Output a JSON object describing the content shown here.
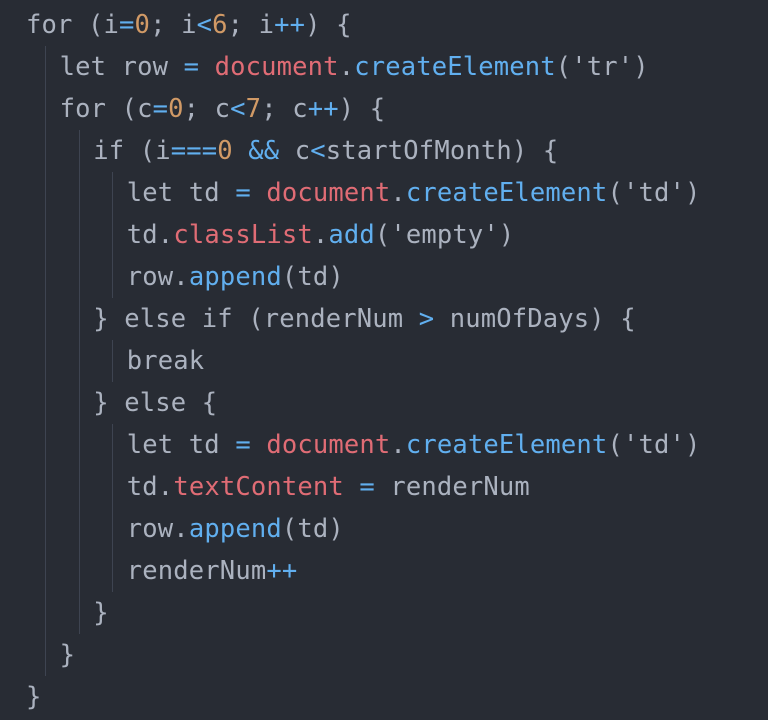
{
  "colors": {
    "background": "#282c34",
    "plain": "#abb2bf",
    "number": "#d19a66",
    "operator": "#61afef",
    "object": "#e06c75",
    "method": "#61afef",
    "property": "#e06c75",
    "guide": "#3e4451"
  },
  "code": {
    "lines": [
      {
        "indent": 0,
        "tokens": [
          {
            "t": "k",
            "v": "for "
          },
          {
            "t": "k",
            "v": "(i"
          },
          {
            "t": "o",
            "v": "="
          },
          {
            "t": "n",
            "v": "0"
          },
          {
            "t": "k",
            "v": "; i"
          },
          {
            "t": "o",
            "v": "<"
          },
          {
            "t": "n",
            "v": "6"
          },
          {
            "t": "k",
            "v": "; i"
          },
          {
            "t": "o",
            "v": "++"
          },
          {
            "t": "k",
            "v": ") {"
          }
        ]
      },
      {
        "indent": 1,
        "tokens": [
          {
            "t": "k",
            "v": "let row "
          },
          {
            "t": "o",
            "v": "="
          },
          {
            "t": "k",
            "v": " "
          },
          {
            "t": "obj",
            "v": "document"
          },
          {
            "t": "k",
            "v": "."
          },
          {
            "t": "fn",
            "v": "createElement"
          },
          {
            "t": "k",
            "v": "("
          },
          {
            "t": "s",
            "v": "'tr'"
          },
          {
            "t": "k",
            "v": ")"
          }
        ]
      },
      {
        "indent": 1,
        "tokens": [
          {
            "t": "k",
            "v": "for (c"
          },
          {
            "t": "o",
            "v": "="
          },
          {
            "t": "n",
            "v": "0"
          },
          {
            "t": "k",
            "v": "; c"
          },
          {
            "t": "o",
            "v": "<"
          },
          {
            "t": "n",
            "v": "7"
          },
          {
            "t": "k",
            "v": "; c"
          },
          {
            "t": "o",
            "v": "++"
          },
          {
            "t": "k",
            "v": ") {"
          }
        ]
      },
      {
        "indent": 2,
        "tokens": [
          {
            "t": "k",
            "v": "if (i"
          },
          {
            "t": "o",
            "v": "==="
          },
          {
            "t": "n",
            "v": "0"
          },
          {
            "t": "k",
            "v": " "
          },
          {
            "t": "o",
            "v": "&&"
          },
          {
            "t": "k",
            "v": " c"
          },
          {
            "t": "o",
            "v": "<"
          },
          {
            "t": "k",
            "v": "startOfMonth) {"
          }
        ]
      },
      {
        "indent": 3,
        "tokens": [
          {
            "t": "k",
            "v": "let td "
          },
          {
            "t": "o",
            "v": "="
          },
          {
            "t": "k",
            "v": " "
          },
          {
            "t": "obj",
            "v": "document"
          },
          {
            "t": "k",
            "v": "."
          },
          {
            "t": "fn",
            "v": "createElement"
          },
          {
            "t": "k",
            "v": "("
          },
          {
            "t": "s",
            "v": "'td'"
          },
          {
            "t": "k",
            "v": ")"
          }
        ]
      },
      {
        "indent": 3,
        "tokens": [
          {
            "t": "k",
            "v": "td."
          },
          {
            "t": "prop",
            "v": "classList"
          },
          {
            "t": "k",
            "v": "."
          },
          {
            "t": "fn",
            "v": "add"
          },
          {
            "t": "k",
            "v": "("
          },
          {
            "t": "s",
            "v": "'empty'"
          },
          {
            "t": "k",
            "v": ")"
          }
        ]
      },
      {
        "indent": 3,
        "tokens": [
          {
            "t": "k",
            "v": "row."
          },
          {
            "t": "fn",
            "v": "append"
          },
          {
            "t": "k",
            "v": "(td)"
          }
        ]
      },
      {
        "indent": 2,
        "tokens": [
          {
            "t": "k",
            "v": "} else if (renderNum "
          },
          {
            "t": "o",
            "v": ">"
          },
          {
            "t": "k",
            "v": " numOfDays) {"
          }
        ]
      },
      {
        "indent": 3,
        "tokens": [
          {
            "t": "k",
            "v": "break"
          }
        ]
      },
      {
        "indent": 2,
        "tokens": [
          {
            "t": "k",
            "v": "} else {"
          }
        ]
      },
      {
        "indent": 3,
        "tokens": [
          {
            "t": "k",
            "v": "let td "
          },
          {
            "t": "o",
            "v": "="
          },
          {
            "t": "k",
            "v": " "
          },
          {
            "t": "obj",
            "v": "document"
          },
          {
            "t": "k",
            "v": "."
          },
          {
            "t": "fn",
            "v": "createElement"
          },
          {
            "t": "k",
            "v": "("
          },
          {
            "t": "s",
            "v": "'td'"
          },
          {
            "t": "k",
            "v": ")"
          }
        ]
      },
      {
        "indent": 3,
        "tokens": [
          {
            "t": "k",
            "v": "td."
          },
          {
            "t": "prop",
            "v": "textContent"
          },
          {
            "t": "k",
            "v": " "
          },
          {
            "t": "o",
            "v": "="
          },
          {
            "t": "k",
            "v": " renderNum"
          }
        ]
      },
      {
        "indent": 3,
        "tokens": [
          {
            "t": "k",
            "v": "row."
          },
          {
            "t": "fn",
            "v": "append"
          },
          {
            "t": "k",
            "v": "(td)"
          }
        ]
      },
      {
        "indent": 3,
        "tokens": [
          {
            "t": "k",
            "v": "renderNum"
          },
          {
            "t": "o",
            "v": "++"
          }
        ]
      },
      {
        "indent": 2,
        "tokens": [
          {
            "t": "k",
            "v": "}"
          }
        ]
      },
      {
        "indent": 1,
        "tokens": [
          {
            "t": "k",
            "v": "}"
          }
        ]
      },
      {
        "indent": 0,
        "tokens": [
          {
            "t": "k",
            "v": "}"
          }
        ]
      }
    ]
  }
}
